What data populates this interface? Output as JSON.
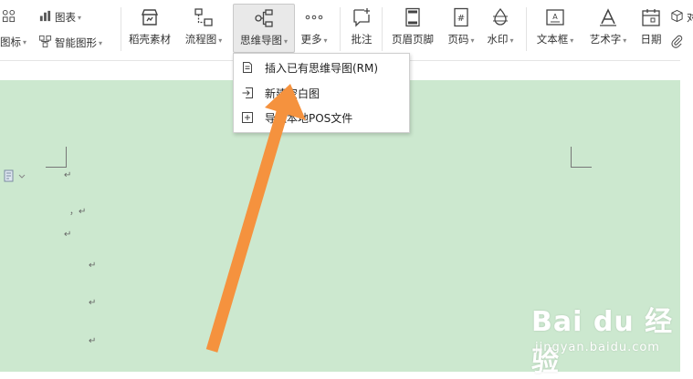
{
  "toolbar": {
    "left_small": {
      "row1_label": "",
      "row2_label": "图标",
      "chart_label": "图表",
      "smart_art_label": "智能图形"
    },
    "daoke_label": "稻壳素材",
    "flowchart_label": "流程图",
    "mindmap_label": "思维导图",
    "more_label": "更多",
    "comment_label": "批注",
    "header_footer_label": "页眉页脚",
    "page_number_label": "页码",
    "watermark_label": "水印",
    "textbox_label": "文本框",
    "wordart_label": "艺术字",
    "date_label": "日期",
    "object_label": "对",
    "attach_label": ""
  },
  "mindmap_menu": {
    "items": [
      {
        "label": "插入已有思维导图(RM)"
      },
      {
        "label": "新建空白图"
      },
      {
        "label": "导入本地POS文件"
      }
    ]
  },
  "document": {
    "mark": "↵",
    "comma_mark": "，↵"
  },
  "watermark": {
    "brand": "Bai du 经验",
    "url": "jingyan.baidu.com"
  },
  "colors": {
    "page_bg": "#cce8cf",
    "arrow": "#f5923e",
    "ribbon_bg": "#ffffff"
  }
}
